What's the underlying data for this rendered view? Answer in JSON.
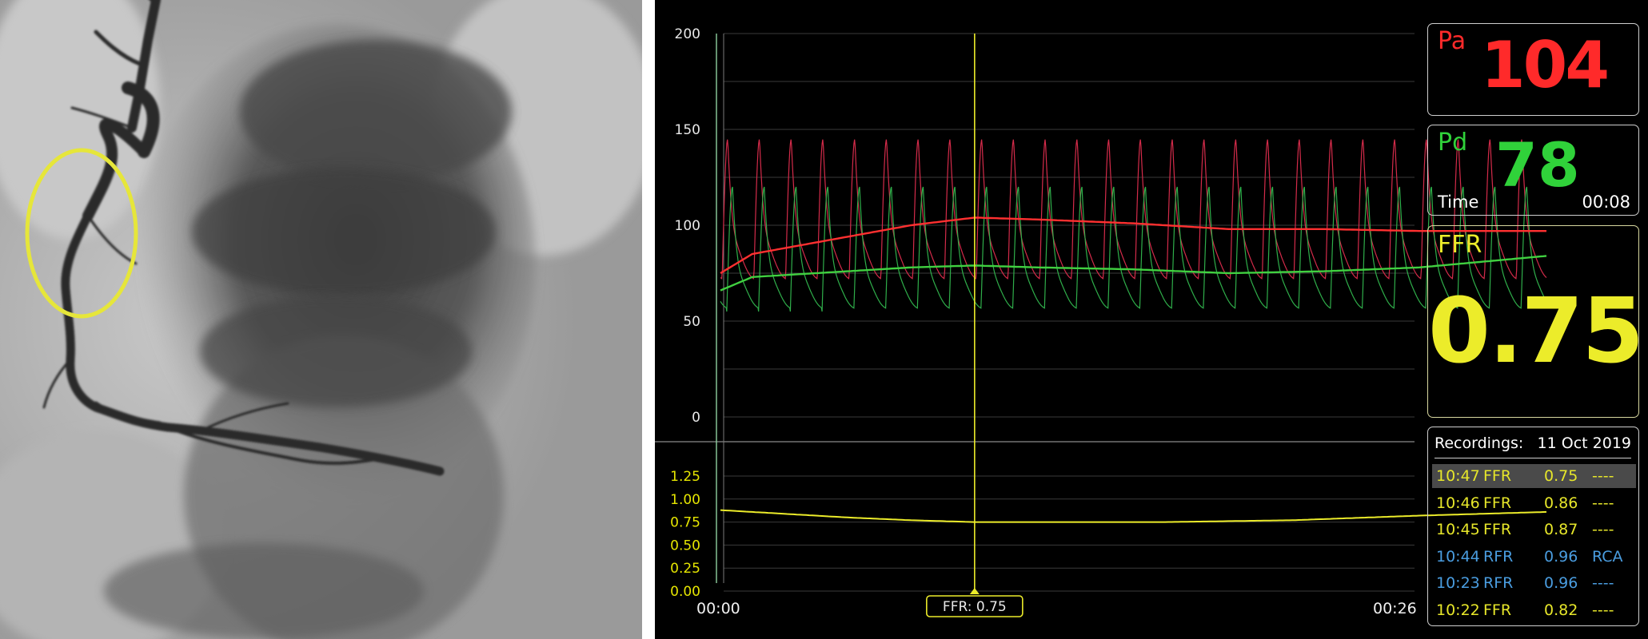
{
  "monitor": {
    "pa": {
      "label": "Pa",
      "value": "104"
    },
    "pd": {
      "label": "Pd",
      "value": "78",
      "time_label": "Time",
      "time_value": "00:08"
    },
    "ffr": {
      "label": "FFR",
      "value": "0.75"
    },
    "cursor_label": "FFR: 0.75",
    "time_start": "00:00",
    "time_end": "00:26",
    "pressure_ticks": [
      "200",
      "150",
      "100",
      "50",
      "0"
    ],
    "ratio_ticks": [
      "1.25",
      "1.00",
      "0.75",
      "0.50",
      "0.25",
      "0.00"
    ],
    "recordings": {
      "header": "Recordings:",
      "date": "11 Oct 2019",
      "rows": [
        {
          "time": "10:47",
          "type": "FFR",
          "value": "0.75",
          "note": "----",
          "color": "#e6e62a",
          "selected": true
        },
        {
          "time": "10:46",
          "type": "FFR",
          "value": "0.86",
          "note": "----",
          "color": "#e6e62a",
          "selected": false
        },
        {
          "time": "10:45",
          "type": "FFR",
          "value": "0.87",
          "note": "----",
          "color": "#e6e62a",
          "selected": false
        },
        {
          "time": "10:44",
          "type": "RFR",
          "value": "0.96",
          "note": "RCA",
          "color": "#4a9de0",
          "selected": false
        },
        {
          "time": "10:23",
          "type": "RFR",
          "value": "0.96",
          "note": "----",
          "color": "#4a9de0",
          "selected": false
        },
        {
          "time": "10:22",
          "type": "FFR",
          "value": "0.82",
          "note": "----",
          "color": "#e6e62a",
          "selected": false
        }
      ]
    },
    "colors": {
      "pa": "#ff2a2a",
      "pd": "#30d23a",
      "ffr": "#ecec2a",
      "rfr": "#4a9de0"
    }
  },
  "chart_data": {
    "type": "line",
    "x_unit": "s",
    "xlim": [
      0,
      26
    ],
    "ylim": [
      0,
      200
    ],
    "series": [
      {
        "name": "Pa",
        "x": [
          0,
          1,
          2,
          4,
          6,
          8,
          10,
          13,
          16,
          19,
          22,
          24,
          26
        ],
        "values": [
          75,
          85,
          88,
          94,
          100,
          104,
          103,
          101,
          98,
          98,
          97,
          97,
          97
        ]
      },
      {
        "name": "Pd",
        "x": [
          0,
          1,
          2,
          4,
          6,
          8,
          10,
          13,
          16,
          19,
          22,
          24,
          26
        ],
        "values": [
          66,
          73,
          74,
          76,
          78,
          79,
          78,
          77,
          75,
          76,
          78,
          81,
          84
        ]
      },
      {
        "name": "FFR",
        "x": [
          0,
          2,
          4,
          6,
          8,
          10,
          14,
          18,
          22,
          26
        ],
        "values": [
          0.88,
          0.84,
          0.8,
          0.77,
          0.75,
          0.75,
          0.75,
          0.77,
          0.82,
          0.86
        ]
      }
    ],
    "phasic": {
      "beats": 26,
      "pa_systolic": 145,
      "pa_diastolic": 70,
      "pd_systolic": 120,
      "pd_diastolic": 55
    },
    "ratio_ylim": [
      0,
      1.25
    ],
    "cursor_x": 8,
    "grid": true
  }
}
